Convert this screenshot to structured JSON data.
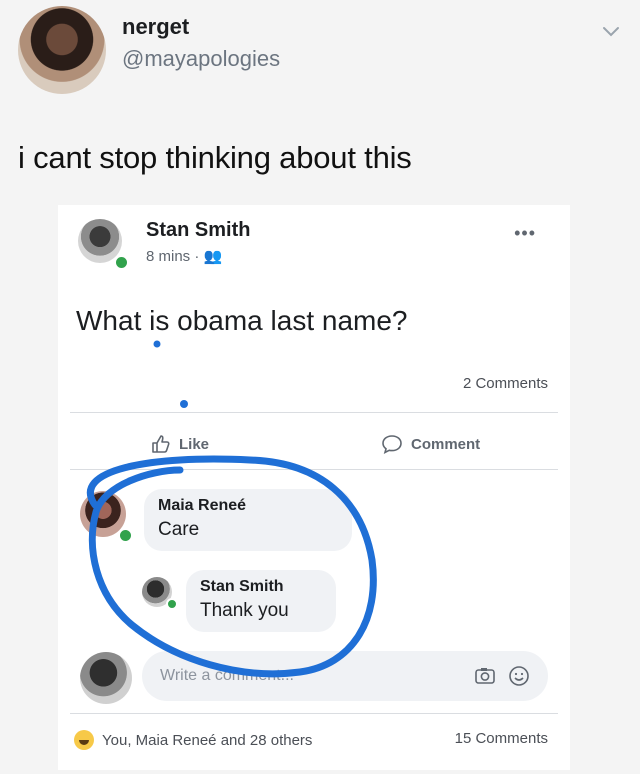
{
  "tweet": {
    "name": "nerget",
    "handle": "@mayapologies",
    "text": "i cant stop thinking about this"
  },
  "post": {
    "author": "Stan Smith",
    "meta": "8 mins · 👥",
    "question": "What is obama last name?",
    "comments_count": "2 Comments",
    "like_label": "Like",
    "comment_label": "Comment",
    "menu": "•••"
  },
  "comments": [
    {
      "author": "Maia Reneé",
      "text": "Care"
    },
    {
      "author": "Stan Smith",
      "text": "Thank you"
    }
  ],
  "composer": {
    "placeholder": "Write a comment..."
  },
  "footer": {
    "reactions": "You, Maia Reneé and 28 others",
    "comments": "15 Comments"
  },
  "colors": {
    "marker": "#1f6fd6",
    "online": "#31a24c"
  }
}
